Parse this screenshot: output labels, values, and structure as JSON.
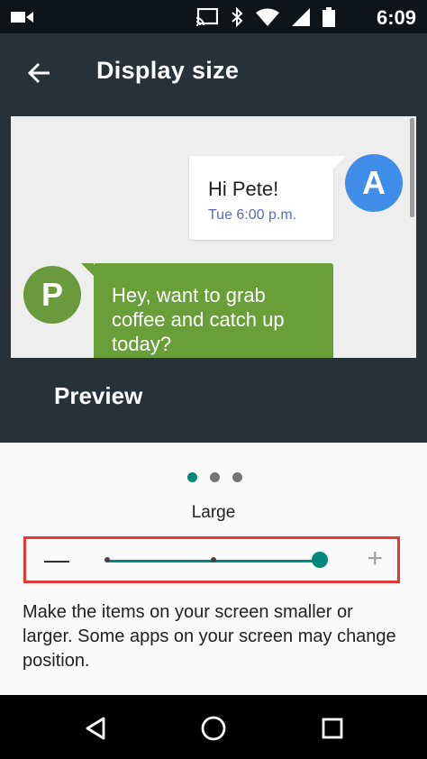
{
  "status_bar": {
    "time": "6:09",
    "icons": [
      "video-camera-icon",
      "cast-icon",
      "bluetooth-icon",
      "wifi-icon",
      "signal-icon",
      "battery-icon"
    ]
  },
  "app_bar": {
    "title": "Display size",
    "back_icon": "arrow-back-icon"
  },
  "preview": {
    "message_a": {
      "avatar_letter": "A",
      "text": "Hi Pete!",
      "timestamp": "Tue 6:00 p.m."
    },
    "message_p": {
      "avatar_letter": "P",
      "text": "Hey, want to grab coffee and catch up today?"
    },
    "label": "Preview"
  },
  "page_indicator": {
    "count": 3,
    "active_index": 0
  },
  "size_control": {
    "current_label": "Large",
    "minus_label": "—",
    "plus_label": "+",
    "level_fraction": 1.0,
    "steps": 3,
    "current_step": 3
  },
  "description": "Make the items on your screen smaller or larger. Some apps on your screen may change position.",
  "colors": {
    "accent": "#00897b",
    "app_bar_bg": "#263238",
    "highlight_border": "#e53935",
    "avatar_a": "#3f8de8",
    "avatar_p": "#6a9a3c",
    "bubble_p": "#689f38",
    "timestamp": "#5c6bc0"
  },
  "nav_bar": {
    "icons": [
      "back-triangle-icon",
      "home-circle-icon",
      "recents-square-icon"
    ]
  }
}
